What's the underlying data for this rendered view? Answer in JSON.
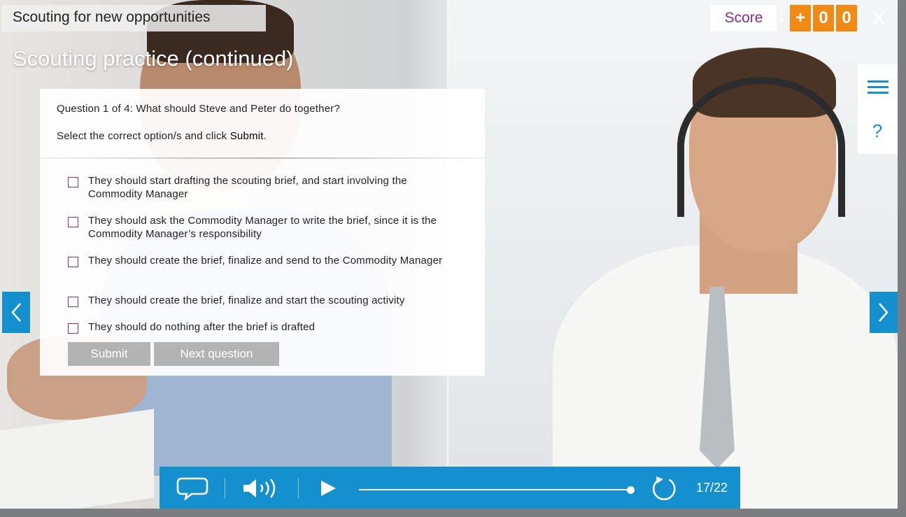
{
  "course": {
    "title": "Scouting for new opportunities"
  },
  "slide": {
    "heading": "Scouting practice (continued)"
  },
  "score": {
    "label": "Score",
    "separator": ":",
    "digits": [
      "+",
      "0",
      "0"
    ],
    "accent_color": "#ef8a14",
    "label_color": "#8a2d8c"
  },
  "close": {
    "label": "X"
  },
  "side_menu": {
    "menu_icon": "hamburger-icon",
    "help_icon": "question-mark-icon",
    "help_label": "?"
  },
  "question": {
    "prompt": "Question 1 of 4: What should Steve and Peter do together?",
    "instruction_prefix": "Select the correct option/s and click ",
    "instruction_emphasis": "Submit",
    "instruction_suffix": ".",
    "options": [
      "They should start drafting the scouting brief, and start involving the Commodity Manager",
      "They should ask the Commodity Manager to write the brief, since it is the Commodity Manager’s responsibility",
      "They should create the brief, finalize and send to the Commodity Manager",
      "They should create the brief, finalize and start the scouting activity",
      "They should do nothing after the brief is drafted"
    ]
  },
  "buttons": {
    "submit": "Submit",
    "next_question": "Next question"
  },
  "navigation": {
    "prev_icon": "chevron-left-icon",
    "next_icon": "chevron-right-icon"
  },
  "player": {
    "transcript_icon": "speech-bubble-icon",
    "audio_icon": "speaker-icon",
    "play_icon": "play-icon",
    "replay_icon": "replay-icon",
    "progress": 1.0,
    "slide_counter": "17/22",
    "bar_color": "#1590cf"
  }
}
